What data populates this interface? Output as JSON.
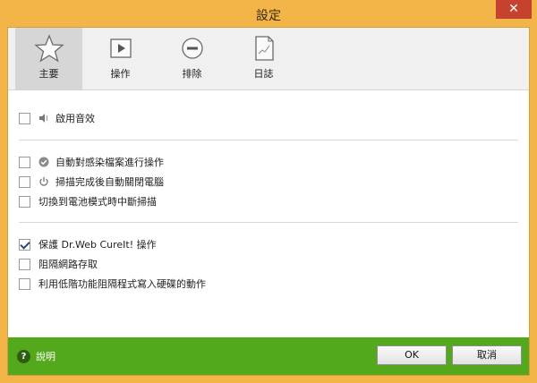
{
  "window": {
    "title": "設定",
    "close_label": "✕"
  },
  "tabs": [
    {
      "label": "主要",
      "icon": "star-icon",
      "active": true
    },
    {
      "label": "操作",
      "icon": "play-icon",
      "active": false
    },
    {
      "label": "排除",
      "icon": "minus-circle-icon",
      "active": false
    },
    {
      "label": "日誌",
      "icon": "log-chart-icon",
      "active": false
    }
  ],
  "options": {
    "sound": {
      "label": "啟用音效",
      "checked": false,
      "icon": "speaker-icon"
    },
    "auto_act": {
      "label": "自動對感染檔案進行操作",
      "checked": false,
      "icon": "check-circle-icon"
    },
    "auto_shutdown": {
      "label": "掃描完成後自動關閉電腦",
      "checked": false,
      "icon": "power-icon"
    },
    "battery_stop": {
      "label": "切換到電池模式時中斷掃描",
      "checked": false
    },
    "protect_self": {
      "label": "保護 Dr.Web CureIt! 操作",
      "checked": true
    },
    "block_network": {
      "label": "阻隔網路存取",
      "checked": false
    },
    "block_lowlevel_disk": {
      "label": "利用低階功能阻隔程式寫入硬碟的動作",
      "checked": false
    }
  },
  "footer": {
    "help_label": "說明",
    "ok_label": "OK",
    "cancel_label": "取消"
  },
  "colors": {
    "title_bar": "#f4b548",
    "close_button": "#c7412f",
    "footer": "#54a81c",
    "active_tab": "#d6d6d6"
  }
}
